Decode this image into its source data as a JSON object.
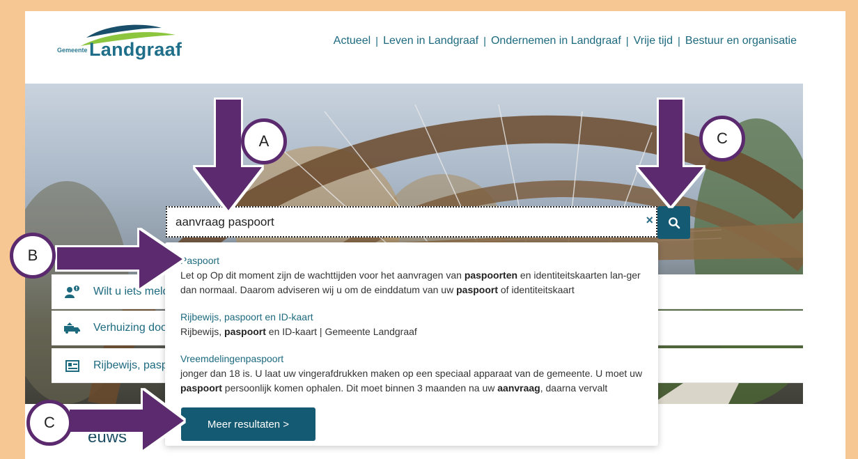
{
  "header": {
    "logo_small": "Gemeente",
    "logo_big": "Landgraaf",
    "nav": [
      "Actueel",
      "Leven in Landgraaf",
      "Ondernemen in Landgraaf",
      "Vrije tijd",
      "Bestuur en organisatie"
    ]
  },
  "search": {
    "value": "aanvraag paspoort",
    "clear_glyph": "×"
  },
  "quick_links": [
    "Wilt u iets meld",
    "Verhuizing door",
    "Rijbewijs, paspo"
  ],
  "results": [
    {
      "title": "Paspoort",
      "desc_html": "Let op Op dit moment zijn de wachttijden voor het aanvragen van <b>paspoorten</b> en identiteitskaarten lan-ger dan normaal. Daarom adviseren wij u om de einddatum van uw <b>paspoort</b> of identiteitskaart"
    },
    {
      "title": "Rijbewijs, paspoort en ID-kaart",
      "desc_html": "Rijbewijs, <b>paspoort</b> en ID-kaart | Gemeente Landgraaf"
    },
    {
      "title": "Vreemdelingenpaspoort",
      "desc_html": "jonger dan 18 is. U laat uw vingerafdrukken maken op een speciaal apparaat van de gemeente. U moet uw <b>paspoort</b> persoonlijk komen ophalen. Dit moet binnen 3 maanden na uw <b>aanvraag</b>, daarna vervalt"
    }
  ],
  "more_button": "Meer resultaten  >",
  "nieuws_heading": "euws",
  "annotations": {
    "a": "A",
    "b": "B",
    "c_top": "C",
    "c_bottom": "C"
  },
  "colors": {
    "frame": "#f6c792",
    "brand": "#155a73",
    "link": "#1d6a7f",
    "annotation": "#5b2a6e"
  }
}
